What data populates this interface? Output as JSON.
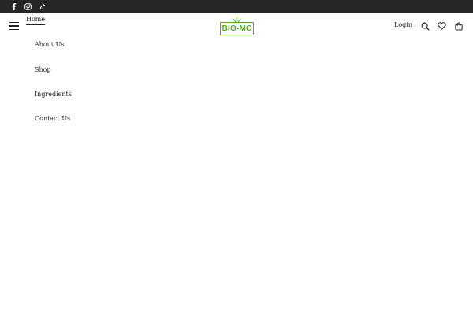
{
  "topbar": {
    "social": [
      {
        "icon": "facebook-icon"
      },
      {
        "icon": "instagram-icon"
      },
      {
        "icon": "tiktok-icon"
      }
    ]
  },
  "header": {
    "logo_text": "BIO-MC",
    "login_label": "Login",
    "icons": [
      "menu-icon",
      "search-icon",
      "heart-icon",
      "cart-icon"
    ]
  },
  "menu": {
    "items": [
      "Home",
      "About Us",
      "Shop",
      "Ingredients",
      "Contact Us"
    ],
    "active": "Home"
  },
  "colors": {
    "topbar_bg": "#262626",
    "brand_green": "#5aa52a",
    "text": "#222222"
  }
}
